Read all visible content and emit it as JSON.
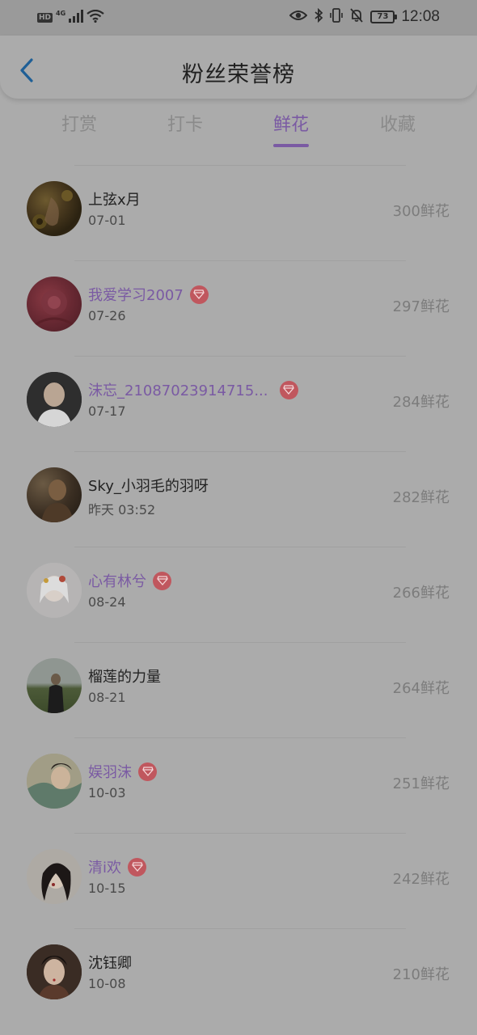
{
  "status_bar": {
    "hd_label": "HD",
    "network_label": "4G",
    "battery_level": "73",
    "time": "12:08"
  },
  "header": {
    "title": "粉丝荣誉榜",
    "back_icon": "chevron-left-icon"
  },
  "tabs": [
    {
      "label": "打赏",
      "active": false
    },
    {
      "label": "打卡",
      "active": false
    },
    {
      "label": "鲜花",
      "active": true
    },
    {
      "label": "收藏",
      "active": false
    }
  ],
  "colors": {
    "accent": "#7a5aa3",
    "vip_badge": "#c0575e"
  },
  "rankings": [
    {
      "name": "上弦x月",
      "date": "07-01",
      "count": "300鲜花",
      "vip": false
    },
    {
      "name": "我爱学习2007",
      "date": "07-26",
      "count": "297鲜花",
      "vip": true
    },
    {
      "name": "沫忘_21087023914715...",
      "date": "07-17",
      "count": "284鲜花",
      "vip": true
    },
    {
      "name": "Sky_小羽毛的羽呀",
      "date": "昨天 03:52",
      "count": "282鲜花",
      "vip": false
    },
    {
      "name": "心有林兮",
      "date": "08-24",
      "count": "266鲜花",
      "vip": true
    },
    {
      "name": "榴莲的力量",
      "date": "08-21",
      "count": "264鲜花",
      "vip": false
    },
    {
      "name": "娱羽沫",
      "date": "10-03",
      "count": "251鲜花",
      "vip": true
    },
    {
      "name": "清i欢",
      "date": "10-15",
      "count": "242鲜花",
      "vip": true
    },
    {
      "name": "沈钰卿",
      "date": "10-08",
      "count": "210鲜花",
      "vip": false
    }
  ]
}
